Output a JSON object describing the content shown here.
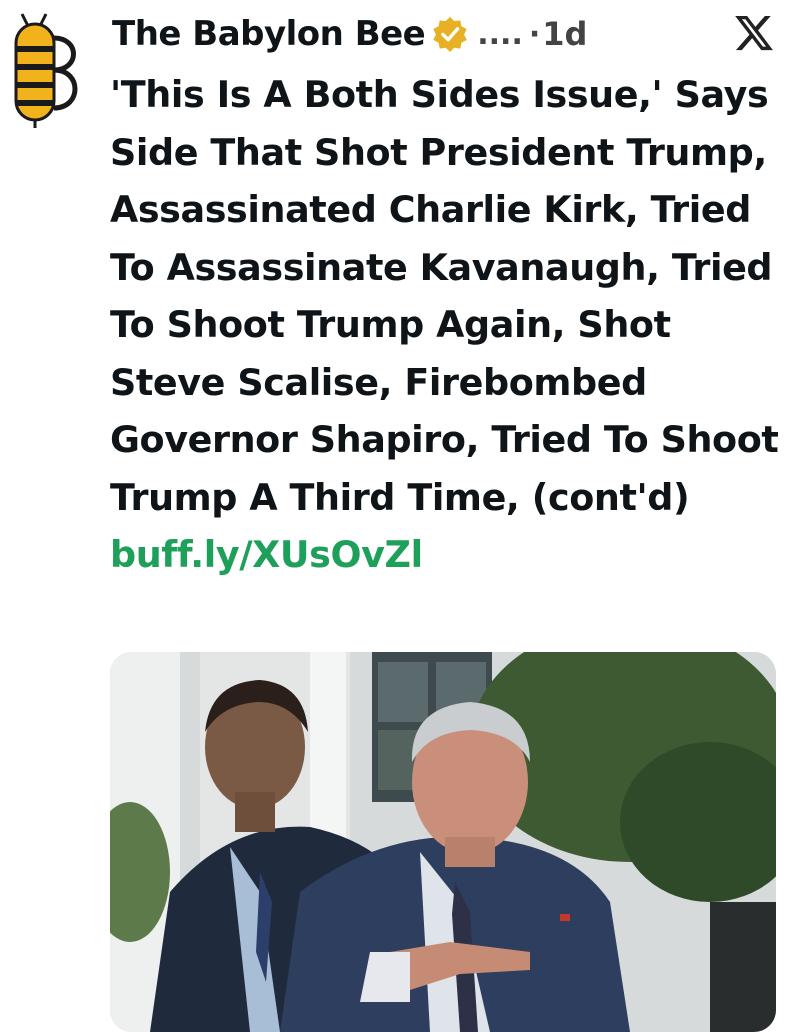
{
  "author": {
    "name": "The Babylon Bee",
    "handle": "....",
    "separator": "·",
    "time": "1d"
  },
  "post": {
    "text": "'This Is A Both Sides Issue,' Says Side That Shot President Trump, Assassinated Charlie Kirk, Tried To Assassinate Kavanaugh, Tried To Shoot Trump Again, Shot Steve Scalise, Firebombed Governor Shapiro, Tried To Shoot Trump A Third Time, (cont'd) ",
    "link": "buff.ly/XUsOvZl"
  },
  "icons": {
    "avatar": "bee-logo-icon",
    "verified": "verified-badge-icon",
    "platform": "x-logo-icon"
  },
  "colors": {
    "link": "#1fa05a",
    "bee_yellow": "#f2b21b",
    "verified_gold": "#e8b024"
  }
}
